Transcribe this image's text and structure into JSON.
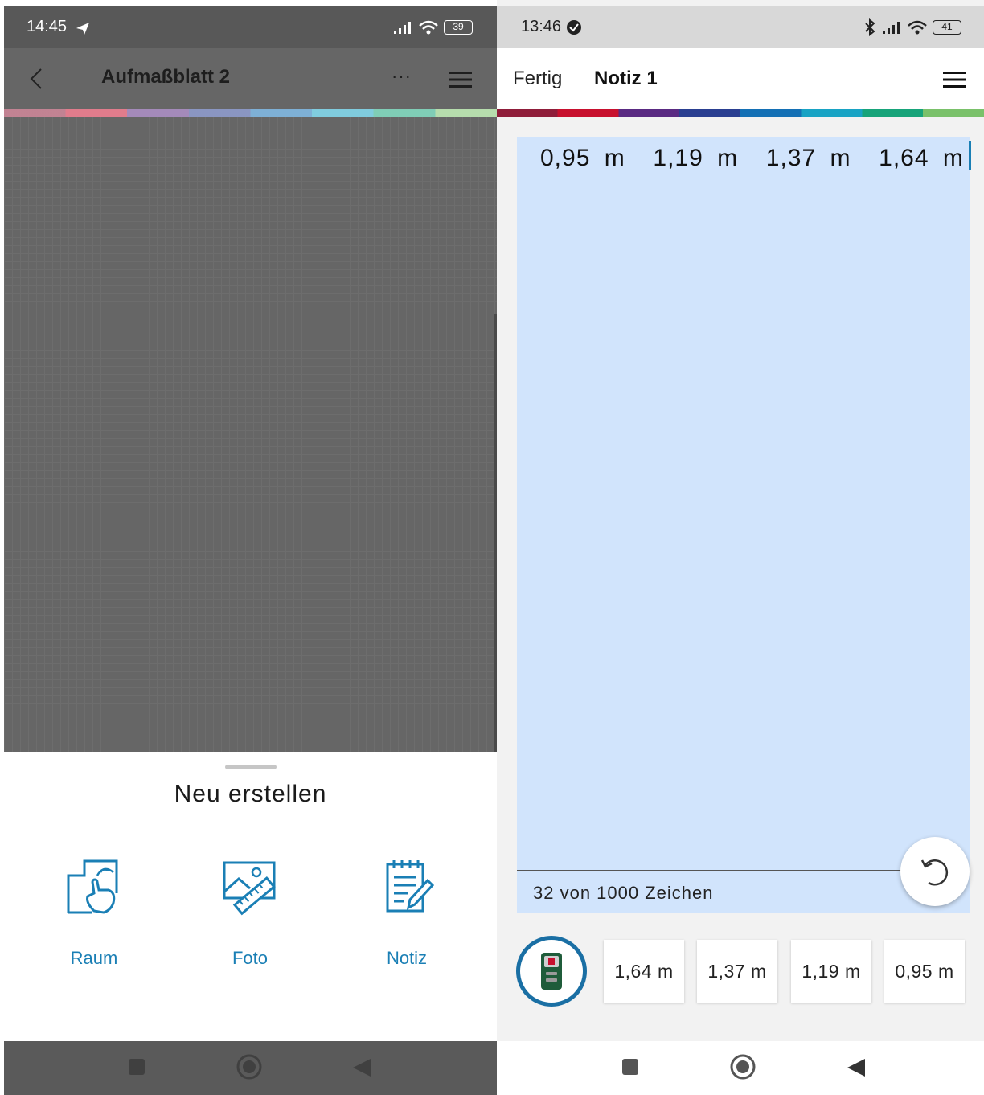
{
  "left": {
    "status": {
      "time": "14:45",
      "battery": "39"
    },
    "header": {
      "title": "Aufmaßblatt 2",
      "more": "···"
    },
    "sheet": {
      "title": "Neu erstellen",
      "options": [
        {
          "label": "Raum",
          "icon": "room-touch-icon"
        },
        {
          "label": "Foto",
          "icon": "photo-ruler-icon"
        },
        {
          "label": "Notiz",
          "icon": "notepad-pen-icon"
        }
      ]
    }
  },
  "right": {
    "status": {
      "time": "13:46",
      "battery": "41"
    },
    "header": {
      "done_label": "Fertig",
      "title": "Notiz 1"
    },
    "note": {
      "text": "0,95 m  1,19 m  1,37 m  1,64 m",
      "counter": "32 von 1000 Zeichen"
    },
    "measurements": [
      "1,64 m",
      "1,37 m",
      "1,19 m",
      "0,95 m"
    ]
  },
  "colors": {
    "accent": "#1a7fb5",
    "note_background": "#d1e4fc",
    "stripe": [
      "#8f1d3a",
      "#c8102e",
      "#5a2a82",
      "#2a3f91",
      "#1470b5",
      "#18a3c4",
      "#17a47a",
      "#7ac16a"
    ]
  }
}
